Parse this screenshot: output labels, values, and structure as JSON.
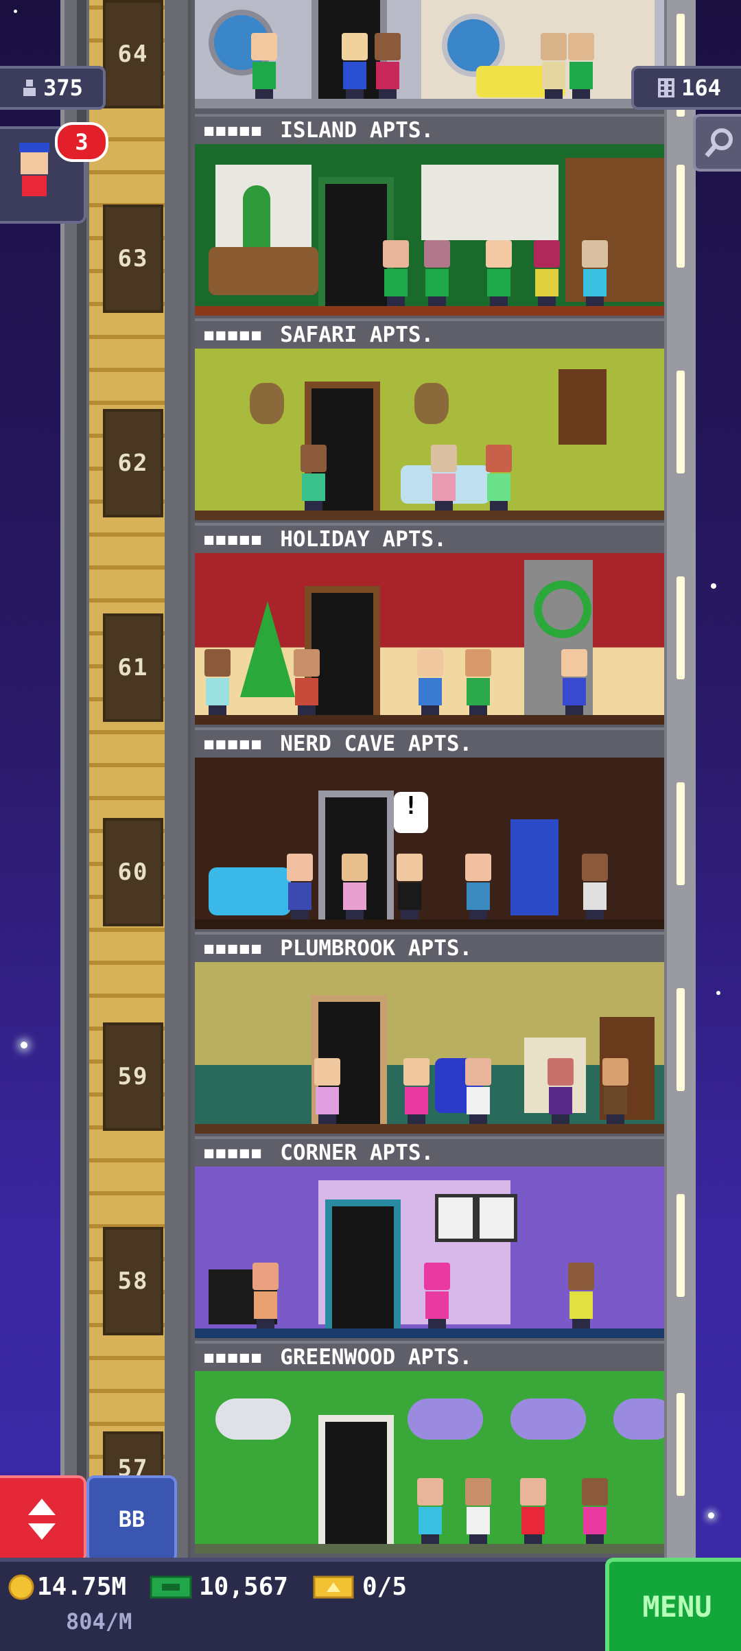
{
  "header": {
    "population": "375",
    "floor_count": "164",
    "visitor_badge": "3"
  },
  "floors": [
    {
      "number": "64",
      "name": ""
    },
    {
      "number": "63",
      "name": "ISLAND APTS."
    },
    {
      "number": "62",
      "name": "SAFARI APTS."
    },
    {
      "number": "61",
      "name": "HOLIDAY APTS."
    },
    {
      "number": "60",
      "name": "NERD CAVE APTS."
    },
    {
      "number": "59",
      "name": "PLUMBROOK APTS."
    },
    {
      "number": "58",
      "name": "CORNER APTS."
    },
    {
      "number": "57",
      "name": "GREENWOOD APTS."
    }
  ],
  "bottom": {
    "coins": "14.75M",
    "coin_rate": "804/M",
    "bux": "10,567",
    "tickets": "0/5",
    "bb_label": "BB",
    "menu_label": "MENU"
  },
  "icons": {
    "population": "person-icon",
    "floors": "building-icon",
    "search": "magnifier-icon",
    "elevator": "elevator-arrows-icon",
    "coin": "coin-icon",
    "bux": "bux-icon",
    "ticket": "golden-ticket-icon"
  },
  "colors": {
    "menu_green": "#13a63a",
    "elevator_red": "#e52838",
    "bb_blue": "#3a56b0",
    "coin_gold": "#f2c232",
    "bux_green": "#21a64a"
  }
}
